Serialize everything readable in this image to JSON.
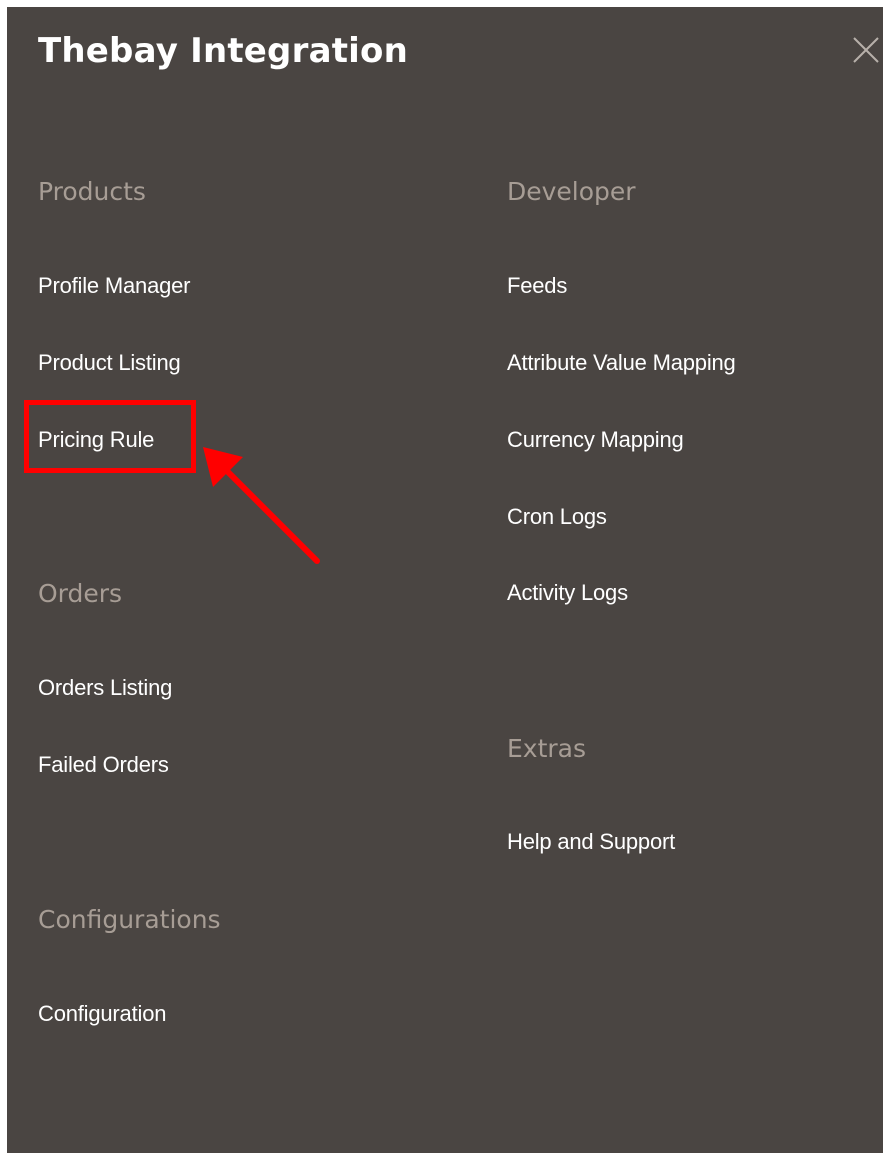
{
  "panel": {
    "title": "Thebay Integration",
    "close_icon": "close-icon"
  },
  "sections": {
    "products": {
      "heading": "Products",
      "items": [
        "Profile Manager",
        "Product Listing",
        "Pricing Rule"
      ]
    },
    "orders": {
      "heading": "Orders",
      "items": [
        "Orders Listing",
        "Failed Orders"
      ]
    },
    "configurations": {
      "heading": "Configurations",
      "items": [
        "Configuration"
      ]
    },
    "developer": {
      "heading": "Developer",
      "items": [
        "Feeds",
        "Attribute Value Mapping",
        "Currency Mapping",
        "Cron Logs",
        "Activity Logs"
      ]
    },
    "extras": {
      "heading": "Extras",
      "items": [
        "Help and Support"
      ]
    }
  },
  "annotation": {
    "highlighted_item": "Pricing Rule",
    "color": "#ff0000"
  },
  "colors": {
    "panel_bg": "#4a4542",
    "heading": "#a79d95",
    "link": "#ffffff"
  }
}
